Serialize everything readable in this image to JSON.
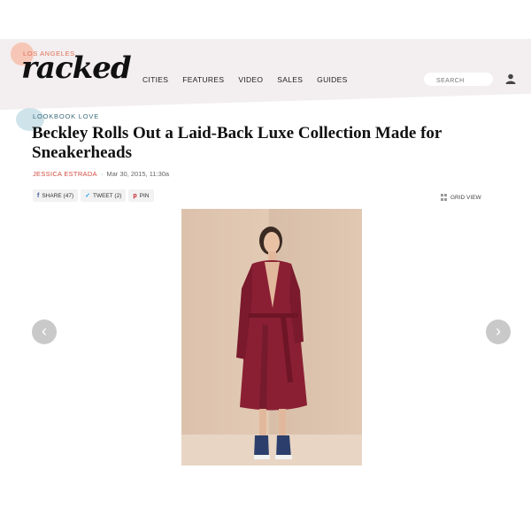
{
  "brand": {
    "city": "LOS ANGELES",
    "name": "racked"
  },
  "nav": {
    "items": [
      "CITIES",
      "FEATURES",
      "VIDEO",
      "SALES",
      "GUIDES"
    ]
  },
  "search": {
    "placeholder": "SEARCH"
  },
  "article": {
    "kicker": "LOOKBOOK LOVE",
    "title": "Beckley Rolls Out a Laid-Back Luxe Collection Made for Sneakerheads",
    "author": "JESSICA ESTRADA",
    "separator": "·",
    "date": "Mar 30, 2015, 11:30a"
  },
  "share": {
    "facebook": {
      "icon": "f",
      "label": "SHARE (47)"
    },
    "twitter": {
      "icon": "✓",
      "label": "TWEET (2)"
    },
    "pinterest": {
      "icon": "p",
      "label": "PIN"
    }
  },
  "gallery": {
    "grid_view_label": "GRID VIEW",
    "prev_arrow": "‹",
    "next_arrow": "›"
  },
  "colors": {
    "header_bg": "#f3eeef",
    "accent_red": "#d24b3f",
    "kicker_teal": "#3b6b7a",
    "dress": "#8a1f33"
  }
}
